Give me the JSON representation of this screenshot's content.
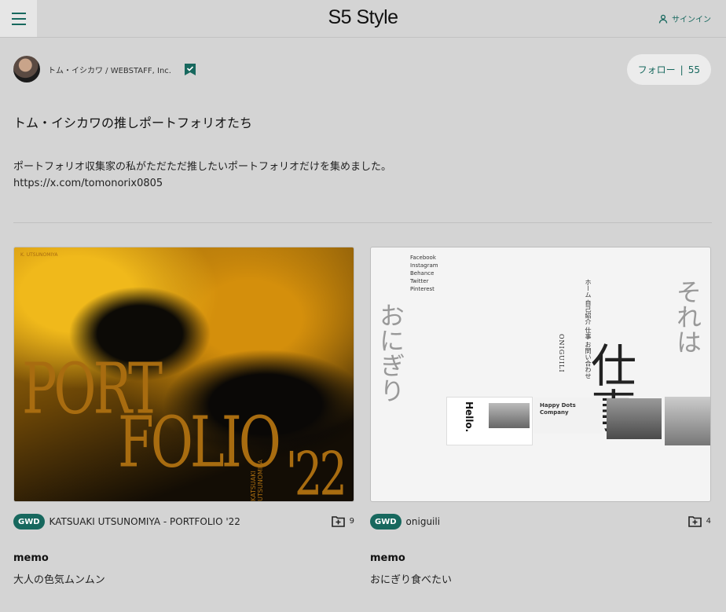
{
  "header": {
    "logo": "S5 Style",
    "signin_label": "サインイン"
  },
  "author": {
    "name": "トム・イシカワ / WEBSTAFF, Inc.",
    "follow_label": "フォロー",
    "follow_separator": "|",
    "follow_count": "55"
  },
  "collection": {
    "title": "トム・イシカワの推しポートフォリオたち",
    "description_line1": "ポートフォリオ収集家の私がただただ推したいポートフォリオだけを集めました。",
    "description_line2": "https://x.com/tomonorix0805"
  },
  "cards": [
    {
      "badge": "GWD",
      "site_name": "KATSUAKI UTSUNOMIYA - PORTFOLIO '22",
      "count": "9",
      "memo_label": "memo",
      "memo_text": "大人の色気ムンムン",
      "thumb_text": {
        "word1": "PORT",
        "word2": "FOLIO",
        "year": "'22",
        "name": "KATSUAKI UTSUNOMIYA",
        "corner": "K. UTSUNOMIYA"
      }
    },
    {
      "badge": "GWD",
      "site_name": "oniguili",
      "count": "4",
      "memo_label": "memo",
      "memo_text": "おにぎり食べたい",
      "thumb_text": {
        "big": "仕事",
        "side_left": "おにぎり",
        "side_right": "それは",
        "hello": "Hello.",
        "happy": "Happy Dots Company",
        "links": "Facebook Instagram Behance Twitter Pinterest",
        "menu": "ホーム 自己紹介 仕事 お問い合わせ",
        "brand": "ONIGUILI"
      }
    }
  ],
  "colors": {
    "accent": "#17685e",
    "background": "#d4d4d4"
  }
}
